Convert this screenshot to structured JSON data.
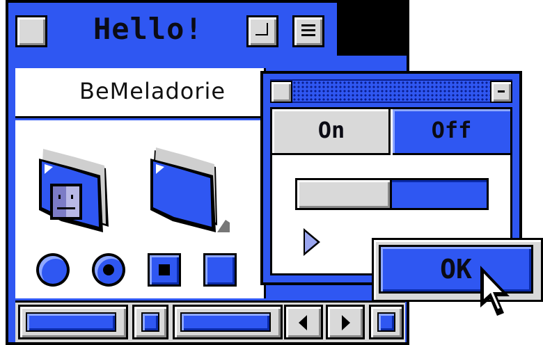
{
  "main_window": {
    "title": "Hello!",
    "name_field": "BeMeladorie"
  },
  "dialog": {
    "tabs": [
      {
        "label": "On"
      },
      {
        "label": "Off"
      }
    ],
    "progress": 0.5
  },
  "ok_button": {
    "label": "OK"
  },
  "icons": [
    "folder-with-finder-face-icon",
    "folder-icon",
    "radio-icon",
    "checkbox-icon",
    "arrow-cursor-icon"
  ],
  "colors": {
    "accent": "#2f57f2",
    "dark_accent": "#0a2aa8",
    "gray": "#d9d9d9"
  }
}
